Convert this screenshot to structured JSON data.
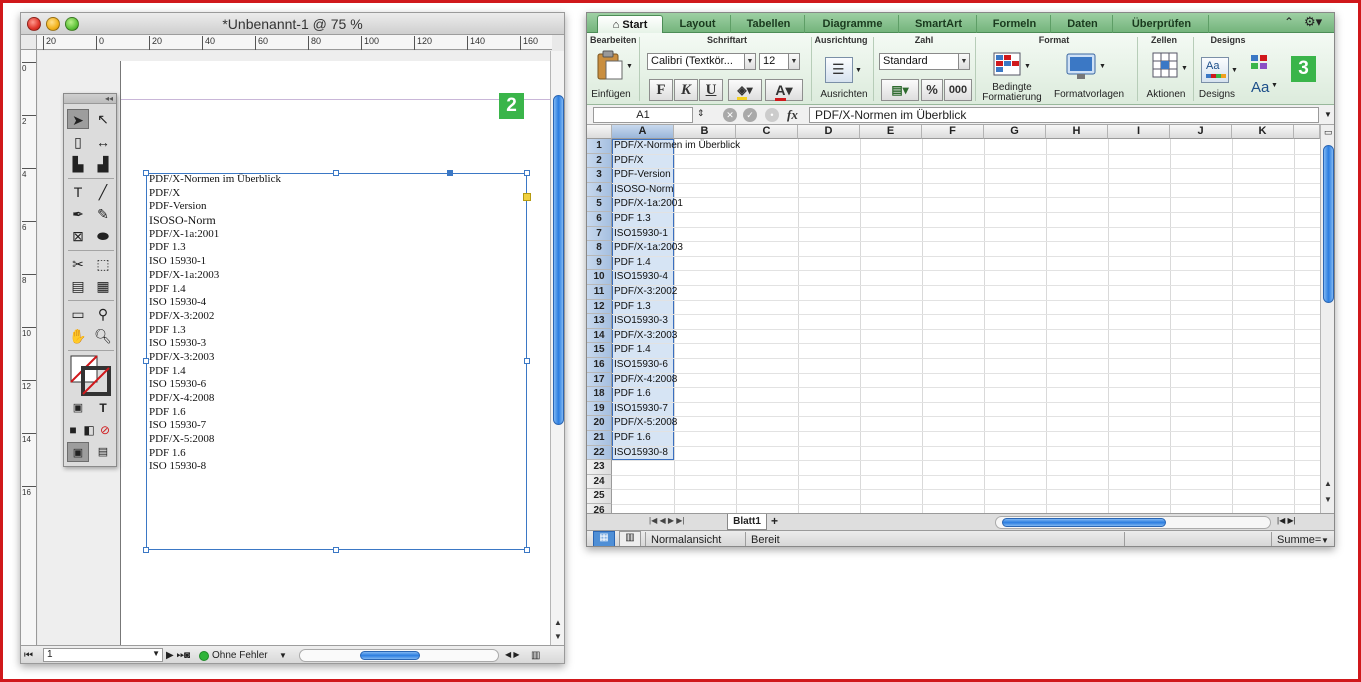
{
  "badges": {
    "left": "2",
    "right": "3"
  },
  "indesign": {
    "window_title": "*Unbenannt-1 @ 75 %",
    "ruler_h": [
      "20",
      "0",
      "20",
      "40",
      "60",
      "80",
      "100",
      "120",
      "140",
      "160"
    ],
    "ruler_v": [
      "0",
      "2",
      "4",
      "6",
      "8",
      "10",
      "12",
      "14",
      "16"
    ],
    "text_lines": [
      "PDF/X-Normen im Überblick",
      "PDF/X",
      "PDF-Version",
      "ISOSO-Norm",
      "PDF/X-1a:2001",
      "PDF 1.3",
      "ISO 15930-1",
      "PDF/X-1a:2003",
      "PDF 1.4",
      "ISO 15930-4",
      "PDF/X-3:2002",
      "PDF 1.3",
      "ISO 15930-3",
      "PDF/X-3:2003",
      "PDF 1.4",
      "ISO 15930-6",
      "PDF/X-4:2008",
      "PDF 1.6",
      "ISO 15930-7",
      "PDF/X-5:2008",
      "PDF 1.6",
      "ISO 15930-8"
    ],
    "status": {
      "page": "1",
      "preflight": "Ohne Fehler"
    }
  },
  "excel": {
    "tabs": [
      "Start",
      "Layout",
      "Tabellen",
      "Diagramme",
      "SmartArt",
      "Formeln",
      "Daten",
      "Überprüfen"
    ],
    "groups": [
      "Bearbeiten",
      "Schriftart",
      "Ausrichtung",
      "Zahl",
      "Format",
      "Zellen",
      "Designs"
    ],
    "buttons": {
      "paste": "Einfügen",
      "align": "Ausrichten",
      "cond_format_1": "Bedingte",
      "cond_format_2": "Formatierung",
      "styles": "Formatvorlagen",
      "actions": "Aktionen",
      "designs": "Designs",
      "bold": "F",
      "italic": "K",
      "underline": "U",
      "percent": "%",
      "thousands": "000",
      "font_color": "A",
      "themes_font": "Aa"
    },
    "font_name": "Calibri (Textkör...",
    "font_size": "12",
    "number_format": "Standard",
    "name_box": "A1",
    "fx": "fx",
    "formula": "PDF/X-Normen im Überblick",
    "columns": [
      "A",
      "B",
      "C",
      "D",
      "E",
      "F",
      "G",
      "H",
      "I",
      "J",
      "K"
    ],
    "rows": [
      "1",
      "2",
      "3",
      "4",
      "5",
      "6",
      "7",
      "8",
      "9",
      "10",
      "11",
      "12",
      "13",
      "14",
      "15",
      "16",
      "17",
      "18",
      "19",
      "20",
      "21",
      "22",
      "23",
      "24",
      "25",
      "26"
    ],
    "cells_a": [
      "PDF/X-Normen im Überblick",
      "PDF/X",
      "PDF-Version",
      "ISOSO-Norm",
      "PDF/X-1a:2001",
      "PDF 1.3",
      "ISO15930-1",
      "PDF/X-1a:2003",
      "PDF 1.4",
      "ISO15930-4",
      "PDF/X-3:2002",
      "PDF 1.3",
      "ISO15930-3",
      "PDF/X-3:2003",
      "PDF 1.4",
      "ISO15930-6",
      "PDF/X-4:2008",
      "PDF 1.6",
      "ISO15930-7",
      "PDF/X-5:2008",
      "PDF 1.6",
      "ISO15930-8"
    ],
    "sheet_tab": "Blatt1",
    "status": {
      "view": "Normalansicht",
      "state": "Bereit",
      "sum": "Summe="
    }
  }
}
